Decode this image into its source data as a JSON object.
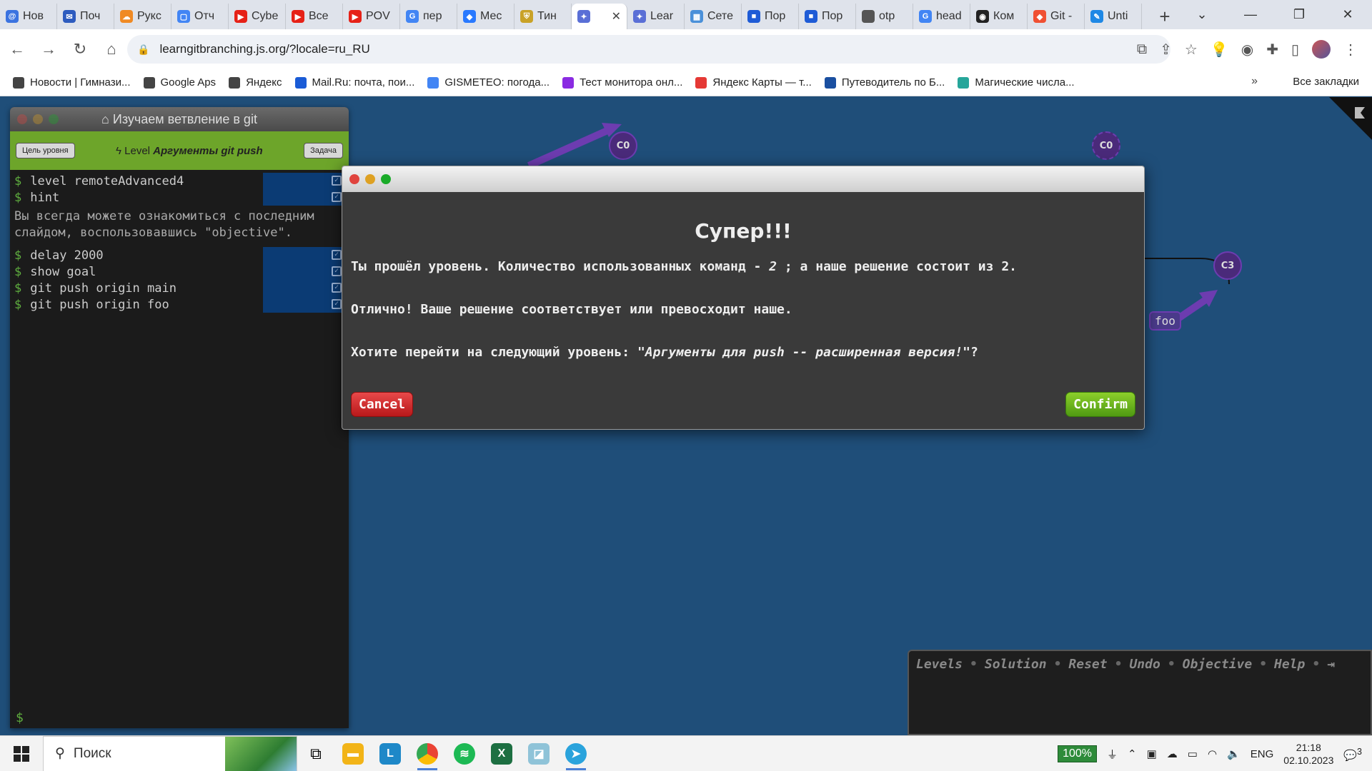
{
  "tabs": [
    {
      "label": "Нов",
      "color": "#3b73e0",
      "glyph": "@"
    },
    {
      "label": "Поч",
      "color": "#2e5cbf",
      "glyph": "✉"
    },
    {
      "label": "Рукс",
      "color": "#f08a24",
      "glyph": "☁"
    },
    {
      "label": "Отч",
      "color": "#4285f4",
      "glyph": "▢"
    },
    {
      "label": "Cybe",
      "color": "#e62117",
      "glyph": "▶"
    },
    {
      "label": "Все",
      "color": "#e62117",
      "glyph": "▶"
    },
    {
      "label": "POV",
      "color": "#e62117",
      "glyph": "▶"
    },
    {
      "label": "пер",
      "color": "#4285f4",
      "glyph": "G"
    },
    {
      "label": "Мес",
      "color": "#2979ff",
      "glyph": "◆"
    },
    {
      "label": "Тин",
      "color": "#c9a227",
      "glyph": "⛨"
    },
    {
      "label": "",
      "color": "#5a6fd6",
      "glyph": "✦",
      "active": true
    },
    {
      "label": "Lear",
      "color": "#5a6fd6",
      "glyph": "✦"
    },
    {
      "label": "Сете",
      "color": "#4a90d9",
      "glyph": "▦"
    },
    {
      "label": "Пор",
      "color": "#1e5bd6",
      "glyph": "■"
    },
    {
      "label": "Пор",
      "color": "#1e5bd6",
      "glyph": "■"
    },
    {
      "label": "otp",
      "color": "#555555",
      "glyph": ""
    },
    {
      "label": "head",
      "color": "#4285f4",
      "glyph": "G"
    },
    {
      "label": "Ком",
      "color": "#222222",
      "glyph": "◉"
    },
    {
      "label": "Git -",
      "color": "#f05033",
      "glyph": "◆"
    },
    {
      "label": "Unti",
      "color": "#1e88e5",
      "glyph": "✎"
    }
  ],
  "address": {
    "url": "learngitbranching.js.org/?locale=ru_RU"
  },
  "bookmarks": [
    {
      "label": "Новости | Гимнази...",
      "color": "#444444"
    },
    {
      "label": "Google Aps",
      "color": "#444444"
    },
    {
      "label": "Яндекс",
      "color": "#444444"
    },
    {
      "label": "Mail.Ru: почта, пои...",
      "color": "#1a5bd6"
    },
    {
      "label": "GISMETEO: погода...",
      "color": "#4285f4"
    },
    {
      "label": "Тест монитора онл...",
      "color": "#8a2be2"
    },
    {
      "label": "Яндекс Карты — т...",
      "color": "#e53935"
    },
    {
      "label": "Путеводитель по Б...",
      "color": "#1a4fa0"
    },
    {
      "label": "Магические числа...",
      "color": "#26a69a"
    }
  ],
  "bookmarks_all": "Все закладки",
  "command_panel": {
    "title": "Изучаем ветвление в git",
    "goal_button": "Цель уровня",
    "task_button": "Задача",
    "level_prefix": "Level",
    "level_name": "Аргументы git push",
    "commands_top": [
      "level remoteAdvanced4",
      "hint"
    ],
    "hint_text": "Вы всегда можете ознакомиться с последним слайдом, воспользовавшись \"objective\".",
    "commands_bottom": [
      "delay 2000",
      "show goal",
      "git push origin main",
      "git push origin foo"
    ],
    "prompt": "$"
  },
  "graph": {
    "nodes": [
      "C0",
      "C0",
      "C3"
    ],
    "branch": "foo"
  },
  "modal": {
    "heading": "Супер!!!",
    "line1_a": "Ты прошёл уровень. Количество использованных команд - ",
    "line1_count": "2",
    "line1_b": " ; а наше решение состоит из 2.",
    "line2": "Отлично! Ваше решение соответствует или превосходит наше.",
    "line3_a": "Хотите перейти на следующий уровень: ",
    "line3_level": "\"Аргументы для push -- расширенная версия!\"",
    "line3_b": "?",
    "cancel": "Cancel",
    "confirm": "Confirm"
  },
  "toolbar": {
    "levels": "Levels",
    "solution": "Solution",
    "reset": "Reset",
    "undo": "Undo",
    "objective": "Objective",
    "help": "Help",
    "sep": "•"
  },
  "taskbar": {
    "search_placeholder": "Поиск",
    "battery": "100%",
    "lang": "ENG",
    "time": "21:18",
    "date": "02.10.2023",
    "notifications": "3"
  }
}
